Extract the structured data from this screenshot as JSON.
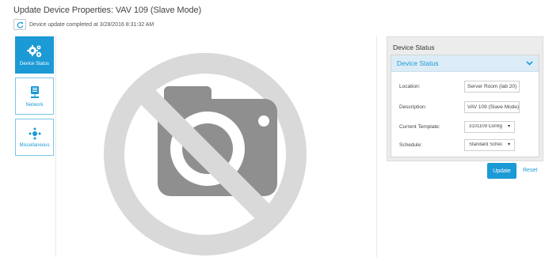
{
  "header": {
    "title": "Update Device Properties: VAV 109 (Slave Mode)",
    "status_message": "Device update completed at 3/28/2016 8:31:32 AM"
  },
  "tabs": [
    {
      "label": "Device Status",
      "icon": "gears-icon",
      "active": true
    },
    {
      "label": "Network",
      "icon": "network-icon",
      "active": false
    },
    {
      "label": "Miscellaneous",
      "icon": "miscellaneous-icon",
      "active": false
    }
  ],
  "image_panel": {
    "icon": "no-image-placeholder-icon"
  },
  "device_status": {
    "card_title": "Device Status",
    "section_title": "Device Status",
    "fields": {
      "location": {
        "label": "Location:",
        "value": "Server Room (lab 20)"
      },
      "description": {
        "label": "Description:",
        "value": "VAV 109 (Slave Mode)"
      },
      "current_template": {
        "label": "Current Template:",
        "value": "3101109 Config"
      },
      "schedule": {
        "label": "Schedule:",
        "value": "Standard Schedule"
      }
    }
  },
  "actions": {
    "update_label": "Update",
    "reset_label": "Reset"
  },
  "colors": {
    "accent": "#1b9ad6",
    "placeholder_gray": "#8f8f8f",
    "prohibit_gray": "#d9d9d9"
  }
}
